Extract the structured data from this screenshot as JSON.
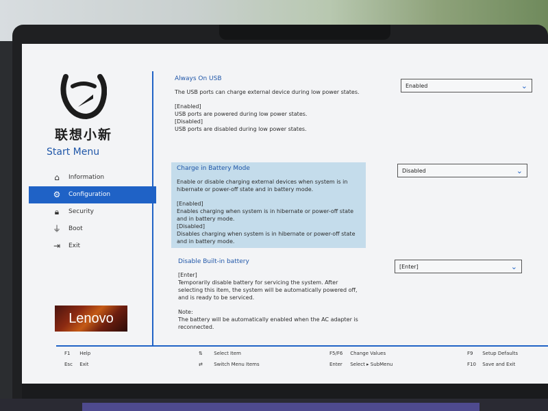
{
  "sidebar": {
    "brand": "联想小新",
    "start_menu": "Start Menu",
    "items": [
      {
        "label": "Information",
        "icon": "home-icon"
      },
      {
        "label": "Configuration",
        "icon": "gear-icon"
      },
      {
        "label": "Security",
        "icon": "lock-icon"
      },
      {
        "label": "Boot",
        "icon": "usb-icon"
      },
      {
        "label": "Exit",
        "icon": "exit-icon"
      }
    ],
    "lenovo_logo": "Lenovo"
  },
  "settings": {
    "always_on_usb": {
      "title": "Always On USB",
      "description": "The USB ports can charge external device during low power states.",
      "option1_label": "[Enabled]",
      "option1_text": "USB ports are powered during low power states.",
      "option2_label": "[Disabled]",
      "option2_text": "USB ports are disabled during low power states.",
      "value": "Enabled"
    },
    "charge_in_battery_mode": {
      "title": "Charge in Battery Mode",
      "description": "Enable or disable charging external devices when system is in hibernate or power-off state and in battery mode.",
      "option1_label": "[Enabled]",
      "option1_text": "Enables charging when system is in hibernate or power-off state and in battery mode.",
      "option2_label": "[Disabled]",
      "option2_text": "Disables charging when system is in hibernate or power-off state and in battery mode.",
      "value": "Disabled"
    },
    "disable_builtin_battery": {
      "title": "Disable Built-in battery",
      "enter_label": "[Enter]",
      "enter_text": "Temporarily disable battery for servicing the system. After selecting this item, the system will be automatically powered off, and is ready to be serviced.",
      "note_label": "Note:",
      "note_text": "The battery will be automatically enabled when the AC adapter is reconnected.",
      "value": "[Enter]"
    }
  },
  "footer": {
    "f1_key": "F1",
    "f1_label": "Help",
    "esc_key": "Esc",
    "esc_label": "Exit",
    "select_item_key": "⇅",
    "select_item_label": "Select Item",
    "switch_menu_key": "⇄",
    "switch_menu_label": "Switch Menu Items",
    "f5f6_key": "F5/F6",
    "f5f6_label": "Change Values",
    "enter_key": "Enter",
    "enter_label": "Select ▸ SubMenu",
    "f9_key": "F9",
    "f9_label": "Setup Defaults",
    "f10_key": "F10",
    "f10_label": "Save and Exit"
  },
  "colors": {
    "accent": "#1f62c6",
    "highlight": "#c4dceb",
    "background": "#f3f4f6"
  }
}
